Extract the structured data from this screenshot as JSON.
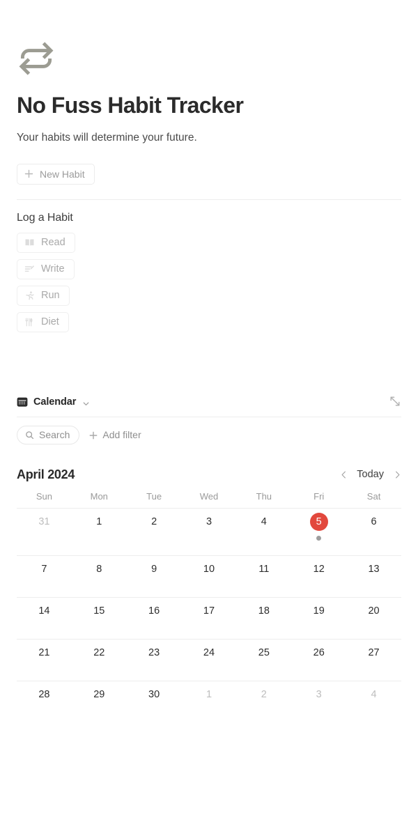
{
  "header": {
    "icon": "repeat-icon",
    "title": "No Fuss Habit Tracker",
    "subtitle": "Your habits will determine your future.",
    "new_habit_label": "New Habit"
  },
  "log_section": {
    "title": "Log a Habit",
    "habits": [
      {
        "label": "Read",
        "icon": "book-icon"
      },
      {
        "label": "Write",
        "icon": "pencil-lines-icon"
      },
      {
        "label": "Run",
        "icon": "running-person-icon"
      },
      {
        "label": "Diet",
        "icon": "utensils-icon"
      }
    ]
  },
  "calendar": {
    "view_name": "Calendar",
    "view_icon": "calendar-icon",
    "expand_icon": "expand-diagonal-icon",
    "search_placeholder": "Search",
    "add_filter_label": "Add filter",
    "month_label": "April 2024",
    "today_label": "Today",
    "prev_label": "‹",
    "next_label": "›",
    "weekdays": [
      "Sun",
      "Mon",
      "Tue",
      "Wed",
      "Thu",
      "Fri",
      "Sat"
    ],
    "today_badge_color": "#e2483d",
    "event_dot_color": "#9e9e9e",
    "weeks": [
      [
        {
          "n": "31",
          "muted": true,
          "today": false,
          "dot": false
        },
        {
          "n": "1",
          "muted": false,
          "today": false,
          "dot": false
        },
        {
          "n": "2",
          "muted": false,
          "today": false,
          "dot": false
        },
        {
          "n": "3",
          "muted": false,
          "today": false,
          "dot": false
        },
        {
          "n": "4",
          "muted": false,
          "today": false,
          "dot": false
        },
        {
          "n": "5",
          "muted": false,
          "today": true,
          "dot": true
        },
        {
          "n": "6",
          "muted": false,
          "today": false,
          "dot": false
        }
      ],
      [
        {
          "n": "7",
          "muted": false,
          "today": false,
          "dot": false
        },
        {
          "n": "8",
          "muted": false,
          "today": false,
          "dot": false
        },
        {
          "n": "9",
          "muted": false,
          "today": false,
          "dot": false
        },
        {
          "n": "10",
          "muted": false,
          "today": false,
          "dot": false
        },
        {
          "n": "11",
          "muted": false,
          "today": false,
          "dot": false
        },
        {
          "n": "12",
          "muted": false,
          "today": false,
          "dot": false
        },
        {
          "n": "13",
          "muted": false,
          "today": false,
          "dot": false
        }
      ],
      [
        {
          "n": "14",
          "muted": false,
          "today": false,
          "dot": false
        },
        {
          "n": "15",
          "muted": false,
          "today": false,
          "dot": false
        },
        {
          "n": "16",
          "muted": false,
          "today": false,
          "dot": false
        },
        {
          "n": "17",
          "muted": false,
          "today": false,
          "dot": false
        },
        {
          "n": "18",
          "muted": false,
          "today": false,
          "dot": false
        },
        {
          "n": "19",
          "muted": false,
          "today": false,
          "dot": false
        },
        {
          "n": "20",
          "muted": false,
          "today": false,
          "dot": false
        }
      ],
      [
        {
          "n": "21",
          "muted": false,
          "today": false,
          "dot": false
        },
        {
          "n": "22",
          "muted": false,
          "today": false,
          "dot": false
        },
        {
          "n": "23",
          "muted": false,
          "today": false,
          "dot": false
        },
        {
          "n": "24",
          "muted": false,
          "today": false,
          "dot": false
        },
        {
          "n": "25",
          "muted": false,
          "today": false,
          "dot": false
        },
        {
          "n": "26",
          "muted": false,
          "today": false,
          "dot": false
        },
        {
          "n": "27",
          "muted": false,
          "today": false,
          "dot": false
        }
      ],
      [
        {
          "n": "28",
          "muted": false,
          "today": false,
          "dot": false
        },
        {
          "n": "29",
          "muted": false,
          "today": false,
          "dot": false
        },
        {
          "n": "30",
          "muted": false,
          "today": false,
          "dot": false
        },
        {
          "n": "1",
          "muted": true,
          "today": false,
          "dot": false
        },
        {
          "n": "2",
          "muted": true,
          "today": false,
          "dot": false
        },
        {
          "n": "3",
          "muted": true,
          "today": false,
          "dot": false
        },
        {
          "n": "4",
          "muted": true,
          "today": false,
          "dot": false
        }
      ]
    ]
  }
}
